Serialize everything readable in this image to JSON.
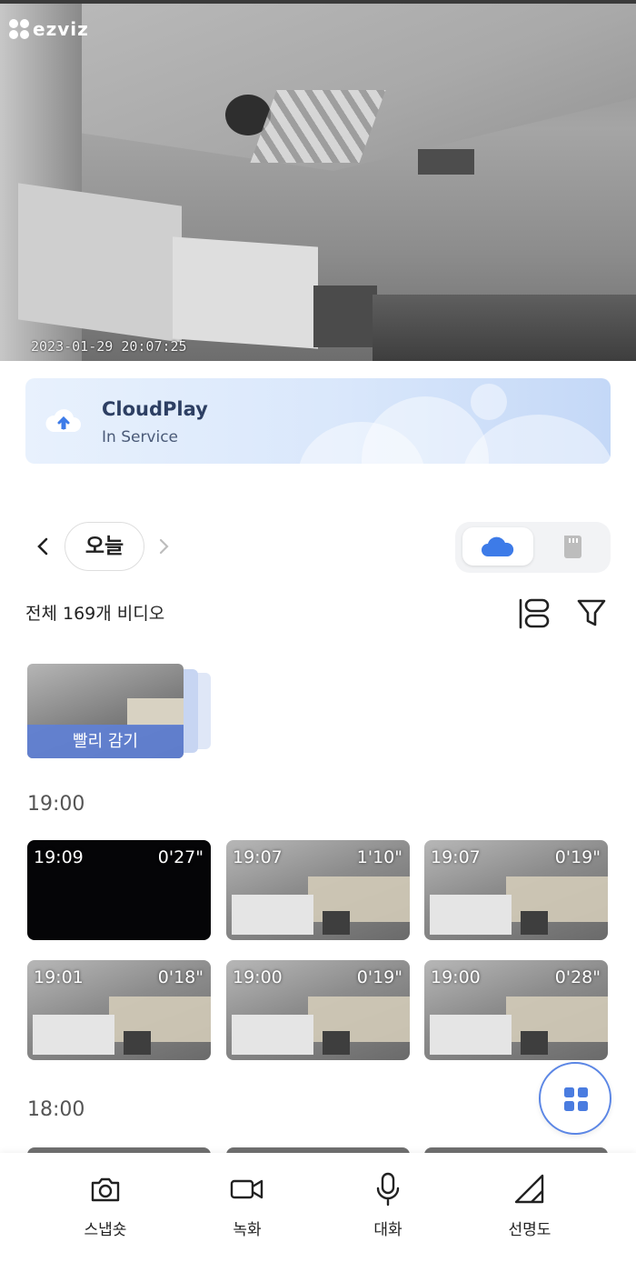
{
  "live_view": {
    "brand": "ezviz",
    "timestamp": "2023-01-29 20:07:25"
  },
  "cloud_banner": {
    "title": "CloudPlay",
    "status": "In Service",
    "icon": "cloud-upload-icon"
  },
  "date_nav": {
    "current": "오늘",
    "prev_icon": "chevron-left-icon",
    "next_icon": "chevron-right-icon"
  },
  "storage_toggle": {
    "selected": "cloud",
    "options": [
      "cloud-icon",
      "sd-card-icon"
    ]
  },
  "summary": {
    "total_text": "전체 169개 비디오"
  },
  "fast_forward": {
    "label": "빨리 감기"
  },
  "sections": [
    {
      "hour": "19:00",
      "clips": [
        {
          "time": "19:09",
          "duration": "0'27\"",
          "dark": true
        },
        {
          "time": "19:07",
          "duration": "1'10\"",
          "dark": false
        },
        {
          "time": "19:07",
          "duration": "0'19\"",
          "dark": false
        },
        {
          "time": "19:01",
          "duration": "0'18\"",
          "dark": false
        },
        {
          "time": "19:00",
          "duration": "0'19\"",
          "dark": false
        },
        {
          "time": "19:00",
          "duration": "0'28\"",
          "dark": false
        }
      ]
    },
    {
      "hour": "18:00",
      "clips": []
    }
  ],
  "bottom_actions": [
    {
      "label": "스냅숏",
      "icon": "camera-icon"
    },
    {
      "label": "녹화",
      "icon": "video-camera-icon"
    },
    {
      "label": "대화",
      "icon": "microphone-icon"
    },
    {
      "label": "선명도",
      "icon": "signal-quality-icon"
    }
  ],
  "colors": {
    "accent": "#5b86e5",
    "cloud_icon": "#3d7be8"
  }
}
